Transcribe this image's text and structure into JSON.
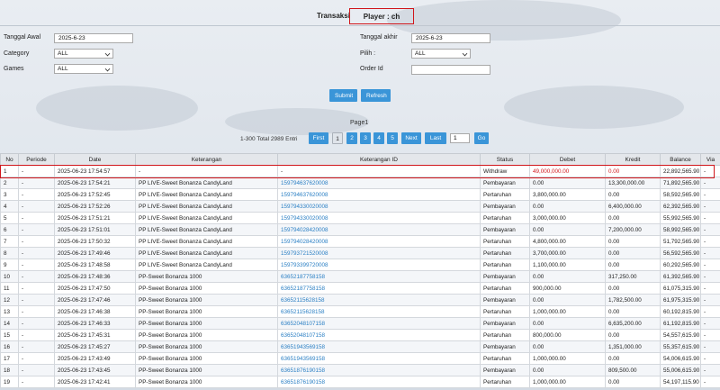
{
  "header": {
    "title": "Transaksi",
    "player": "Player : ch"
  },
  "filters": {
    "tanggal_awal_label": "Tanggal Awal",
    "tanggal_awal_value": "2025-6-23",
    "category_label": "Category",
    "category_value": "ALL",
    "games_label": "Games",
    "games_value": "ALL",
    "tanggal_akhir_label": "Tanggal akhir",
    "tanggal_akhir_value": "2025-6-23",
    "pilih_label": "Pilih :",
    "pilih_value": "ALL",
    "order_id_label": "Order Id",
    "order_id_value": "",
    "submit_label": "Submit",
    "refresh_label": "Refresh"
  },
  "pagination": {
    "page_label": "Page1",
    "entries": "1-300 Total 2989 Entri",
    "first": "First",
    "pages": [
      "1",
      "2",
      "3",
      "4",
      "5"
    ],
    "next": "Next",
    "last": "Last",
    "goto_value": "1",
    "go": "Go"
  },
  "table": {
    "headers": [
      "No",
      "Periode",
      "Date",
      "Keterangan",
      "Keterangan ID",
      "Status",
      "Debet",
      "Kredit",
      "Balance",
      "Via"
    ],
    "rows": [
      [
        "1",
        "-",
        "2025-06-23 17:54:57",
        "-",
        "-",
        "Withdraw",
        "49,000,000.00",
        "0.00",
        "22,892,565.90",
        "-"
      ],
      [
        "2",
        "-",
        "2025-06-23 17:54:21",
        "PP LIVE-Sweet Bonanza CandyLand",
        "159794637620008",
        "Pembayaran",
        "0.00",
        "13,300,000.00",
        "71,892,565.90",
        "-"
      ],
      [
        "3",
        "-",
        "2025-06-23 17:52:45",
        "PP LIVE-Sweet Bonanza CandyLand",
        "159794637620008",
        "Pertaruhan",
        "3,800,000.00",
        "0.00",
        "58,592,565.90",
        "-"
      ],
      [
        "4",
        "-",
        "2025-06-23 17:52:26",
        "PP LIVE-Sweet Bonanza CandyLand",
        "159794330020008",
        "Pembayaran",
        "0.00",
        "6,400,000.00",
        "62,392,565.90",
        "-"
      ],
      [
        "5",
        "-",
        "2025-06-23 17:51:21",
        "PP LIVE-Sweet Bonanza CandyLand",
        "159794330020008",
        "Pertaruhan",
        "3,000,000.00",
        "0.00",
        "55,992,565.90",
        "-"
      ],
      [
        "6",
        "-",
        "2025-06-23 17:51:01",
        "PP LIVE-Sweet Bonanza CandyLand",
        "159794028420008",
        "Pembayaran",
        "0.00",
        "7,200,000.00",
        "58,992,565.90",
        "-"
      ],
      [
        "7",
        "-",
        "2025-06-23 17:50:32",
        "PP LIVE-Sweet Bonanza CandyLand",
        "159794028420008",
        "Pertaruhan",
        "4,800,000.00",
        "0.00",
        "51,792,565.90",
        "-"
      ],
      [
        "8",
        "-",
        "2025-06-23 17:49:46",
        "PP LIVE-Sweet Bonanza CandyLand",
        "159793721520008",
        "Pertaruhan",
        "3,700,000.00",
        "0.00",
        "56,592,565.90",
        "-"
      ],
      [
        "9",
        "-",
        "2025-06-23 17:48:58",
        "PP LIVE-Sweet Bonanza CandyLand",
        "159793399720008",
        "Pertaruhan",
        "1,100,000.00",
        "0.00",
        "60,292,565.90",
        "-"
      ],
      [
        "10",
        "-",
        "2025-06-23 17:48:36",
        "PP-Sweet Bonanza 1000",
        "63652187758158",
        "Pembayaran",
        "0.00",
        "317,250.00",
        "61,392,565.90",
        "-"
      ],
      [
        "11",
        "-",
        "2025-06-23 17:47:50",
        "PP-Sweet Bonanza 1000",
        "63652187758158",
        "Pertaruhan",
        "900,000.00",
        "0.00",
        "61,075,315.90",
        "-"
      ],
      [
        "12",
        "-",
        "2025-06-23 17:47:46",
        "PP-Sweet Bonanza 1000",
        "63652115628158",
        "Pembayaran",
        "0.00",
        "1,782,500.00",
        "61,975,315.90",
        "-"
      ],
      [
        "13",
        "-",
        "2025-06-23 17:46:38",
        "PP-Sweet Bonanza 1000",
        "63652115628158",
        "Pertaruhan",
        "1,000,000.00",
        "0.00",
        "60,192,815.90",
        "-"
      ],
      [
        "14",
        "-",
        "2025-06-23 17:46:33",
        "PP-Sweet Bonanza 1000",
        "63652048107158",
        "Pembayaran",
        "0.00",
        "6,635,200.00",
        "61,192,815.90",
        "-"
      ],
      [
        "15",
        "-",
        "2025-06-23 17:45:31",
        "PP-Sweet Bonanza 1000",
        "63652048107158",
        "Pertaruhan",
        "800,000.00",
        "0.00",
        "54,557,615.90",
        "-"
      ],
      [
        "16",
        "-",
        "2025-06-23 17:45:27",
        "PP-Sweet Bonanza 1000",
        "63651943569158",
        "Pembayaran",
        "0.00",
        "1,351,000.00",
        "55,357,615.90",
        "-"
      ],
      [
        "17",
        "-",
        "2025-06-23 17:43:49",
        "PP-Sweet Bonanza 1000",
        "63651943569158",
        "Pertaruhan",
        "1,000,000.00",
        "0.00",
        "54,006,615.90",
        "-"
      ],
      [
        "18",
        "-",
        "2025-06-23 17:43:45",
        "PP-Sweet Bonanza 1000",
        "63651876190158",
        "Pembayaran",
        "0.00",
        "809,500.00",
        "55,006,615.90",
        "-"
      ],
      [
        "19",
        "-",
        "2025-06-23 17:42:41",
        "PP-Sweet Bonanza 1000",
        "63651876190158",
        "Pertaruhan",
        "1,000,000.00",
        "0.00",
        "54,197,115.90",
        "-"
      ]
    ]
  },
  "colors": {
    "accent": "#3a95d8",
    "highlight": "#d0161b",
    "link": "#2a7fc4"
  }
}
